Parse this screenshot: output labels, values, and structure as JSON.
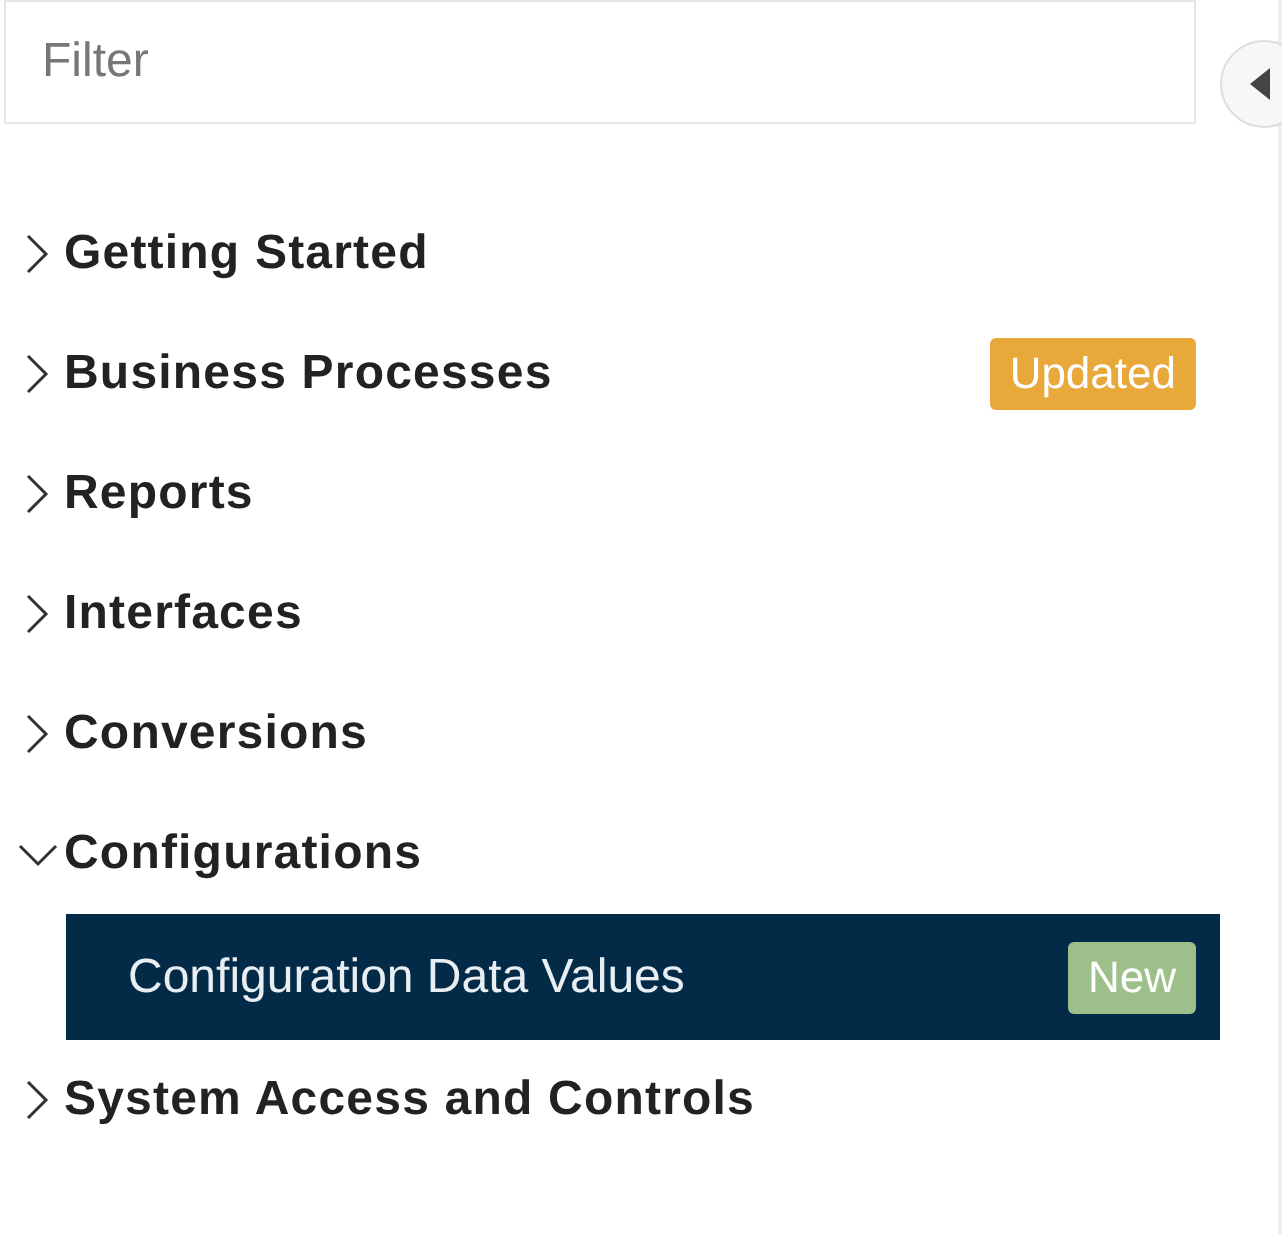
{
  "filter": {
    "placeholder": "Filter"
  },
  "tree": [
    {
      "label": "Getting Started",
      "expanded": false
    },
    {
      "label": "Business Processes",
      "expanded": false,
      "badge": {
        "text": "Updated",
        "color": "#e8a83a"
      }
    },
    {
      "label": "Reports",
      "expanded": false
    },
    {
      "label": "Interfaces",
      "expanded": false
    },
    {
      "label": "Conversions",
      "expanded": false
    },
    {
      "label": "Configurations",
      "expanded": true,
      "children": [
        {
          "label": "Configuration Data Values",
          "selected": true,
          "badge": {
            "text": "New",
            "color": "#9dc08b"
          }
        }
      ]
    },
    {
      "label": "System Access and Controls",
      "expanded": false
    }
  ]
}
